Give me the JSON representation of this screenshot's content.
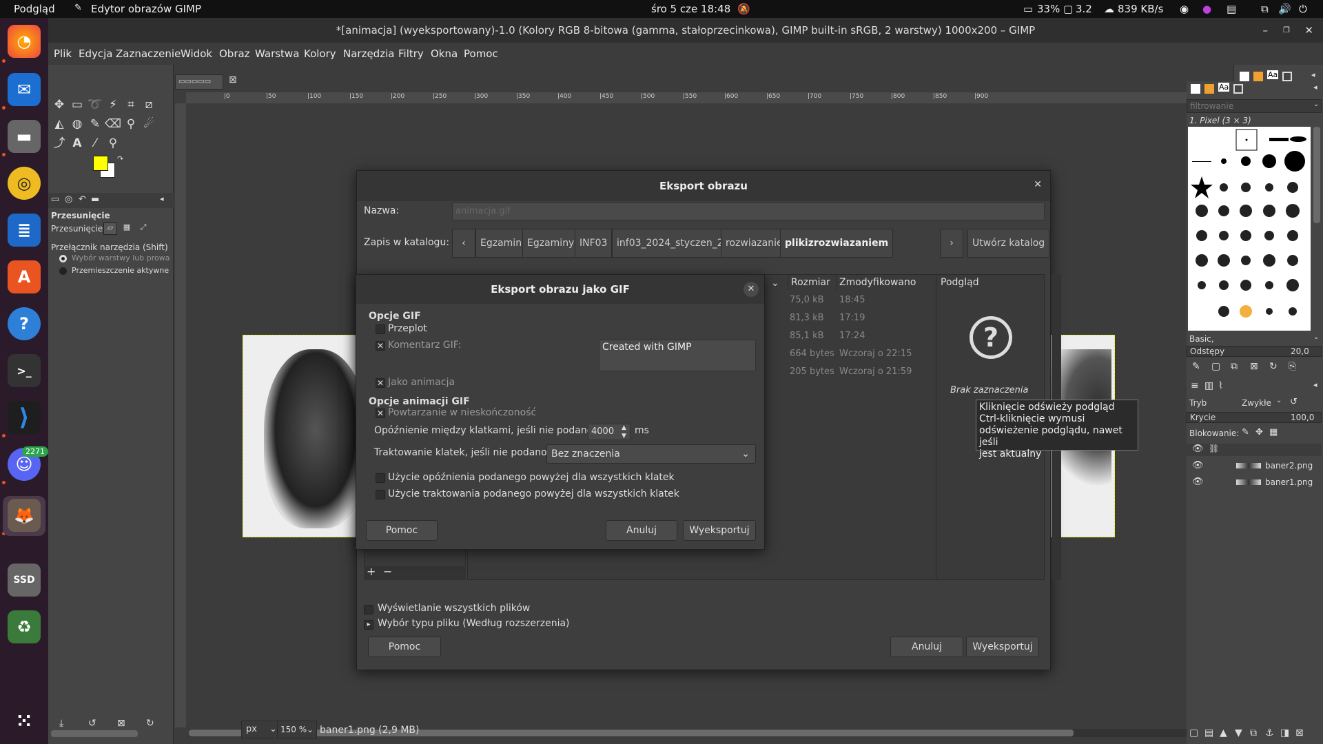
{
  "topbar": {
    "activities": "Podgląd",
    "app_name": "Edytor obrazów GIMP",
    "clock": "śro 5 cze  18:48",
    "battery": "33%",
    "load": "3.2",
    "net": "839 KB/s"
  },
  "dock": {
    "discord_badge": "2271",
    "ssd_label": "SSD"
  },
  "window": {
    "title": "*[animacja] (wyeksportowany)-1.0 (Kolory RGB 8-bitowa (gamma, stałoprzecinkowa), GIMP built-in sRGB, 2 warstwy) 1000x200 – GIMP"
  },
  "menu": [
    "Plik",
    "Edycja",
    "Zaznaczenie",
    "Widok",
    "Obraz",
    "Warstwa",
    "Kolory",
    "Narzędzia",
    "Filtry",
    "Okna",
    "Pomoc"
  ],
  "colors": {
    "fg": "#ffff00",
    "bg": "#ffffff"
  },
  "tool_options": {
    "title": "Przesunięcie",
    "mode_label": "Przesunięcie:",
    "switch_label": "Przełącznik narzędzia  (Shift)",
    "opt1": "Wybór warstwy lub prowa",
    "opt2": "Przemieszczenie aktywne"
  },
  "ruler_ticks": [
    "|0",
    "|50",
    "|100",
    "|150",
    "|200",
    "|250",
    "|300",
    "|350",
    "|400",
    "|450",
    "|500",
    "|550",
    "|600",
    "|650",
    "|700",
    "|750",
    "|800",
    "|850",
    "|900"
  ],
  "status": {
    "unit": "px",
    "zoom": "150 %",
    "file": "baner1.png (2,9 MB)"
  },
  "export_dialog": {
    "title": "Eksport obrazu",
    "name_label": "Nazwa:",
    "name_value": "animacja.gif",
    "folder_label": "Zapis w katalogu:",
    "crumbs": [
      "Egzamin",
      "Egzaminy",
      "INF03",
      "inf03_2024_styczen_2",
      "rozwiazanie",
      "plikizrozwiazaniem"
    ],
    "create_folder": "Utwórz katalog",
    "col_size": "Rozmiar",
    "col_modified": "Zmodyfikowano",
    "files": [
      {
        "size": "75,0 kB",
        "mod": "18:45"
      },
      {
        "size": "81,3 kB",
        "mod": "17:19"
      },
      {
        "size": "85,1 kB",
        "mod": "17:24"
      },
      {
        "size": "664 bytes",
        "mod": "Wczoraj o 22:15"
      },
      {
        "size": "205 bytes",
        "mod": "Wczoraj o 21:59"
      }
    ],
    "preview_title": "Podgląd",
    "no_selection": "Brak zaznaczenia",
    "show_all": "Wyświetlanie wszystkich plików",
    "file_type": "Wybór typu pliku (Według rozszerzenia)",
    "help": "Pomoc",
    "cancel": "Anuluj",
    "export": "Wyeksportuj"
  },
  "tooltip": {
    "l1": "Kliknięcie odświeży podgląd",
    "l2": "Ctrl-kliknięcie wymusi",
    "l3": "odświeżenie podglądu, nawet jeśli",
    "l4": "jest aktualny"
  },
  "gif_dialog": {
    "title": "Eksport obrazu jako GIF",
    "section1": "Opcje GIF",
    "interlace": "Przeplot",
    "comment_label": "Komentarz GIF:",
    "comment_value": "Created with GIMP",
    "as_animation": "Jako animacja",
    "section2": "Opcje animacji GIF",
    "loop": "Powtarzanie w nieskończoność",
    "delay_label": "Opóźnienie między klatkami, jeśli nie podano:",
    "delay_value": "4000",
    "delay_unit": "ms",
    "disposal_label": "Traktowanie klatek, jeśli nie podano:",
    "disposal_value": "Bez znaczenia",
    "use_delay": "Użycie opóźnienia podanego powyżej dla wszystkich klatek",
    "use_disposal": "Użycie traktowania podanego powyżej dla wszystkich klatek",
    "help": "Pomoc",
    "cancel": "Anuluj",
    "export": "Wyeksportuj"
  },
  "brushes": {
    "filter_placeholder": "filtrowanie",
    "selected": "1. Pixel (3 × 3)",
    "preset": "Basic,",
    "spacing_label": "Odstępy",
    "spacing_value": "20,0"
  },
  "layers": {
    "mode_label": "Tryb",
    "mode_value": "Zwykłe",
    "opacity_label": "Krycie",
    "opacity_value": "100,0",
    "lock_label": "Blokowanie:",
    "items": [
      "baner2.png",
      "baner1.png"
    ]
  }
}
